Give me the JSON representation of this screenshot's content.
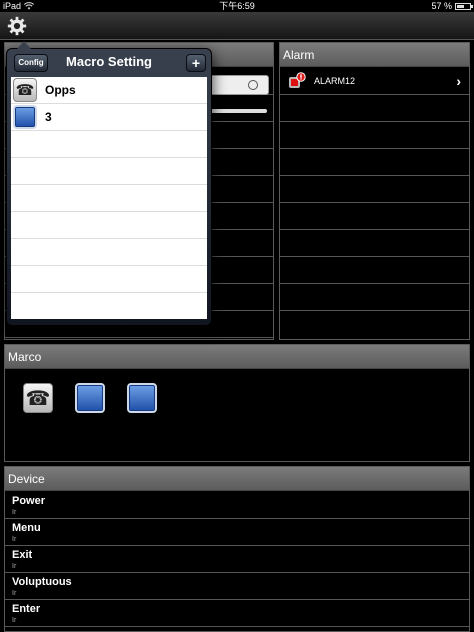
{
  "status_bar": {
    "device": "iPad",
    "time": "下午6:59",
    "battery": "57 %",
    "battery_level": 0.57
  },
  "toolbar": {
    "settings_icon": "gear-icon"
  },
  "alarm": {
    "title": "Alarm",
    "items": [
      {
        "label": "ALARM12",
        "icon": "alarm-icon"
      }
    ]
  },
  "marco": {
    "title": "Marco",
    "icons": [
      "phone-icon",
      "blue-macro-icon",
      "blue-macro-icon"
    ]
  },
  "device": {
    "title": "Device",
    "items": [
      {
        "name": "Power",
        "type": "Ir"
      },
      {
        "name": "Menu",
        "type": "Ir"
      },
      {
        "name": "Exit",
        "type": "Ir"
      },
      {
        "name": "Voluptuous",
        "type": "Ir"
      },
      {
        "name": "Enter",
        "type": "Ir"
      }
    ]
  },
  "macro_setting": {
    "title": "Macro Setting",
    "config_label": "Config",
    "add_label": "+",
    "items": [
      {
        "label": "Opps",
        "icon": "phone-icon"
      },
      {
        "label": "3",
        "icon": "blue-macro-icon"
      }
    ]
  },
  "colors": {
    "header": "#6b6b6b",
    "popover": "#1e2531",
    "accent_blue": "#2b5fb8"
  }
}
